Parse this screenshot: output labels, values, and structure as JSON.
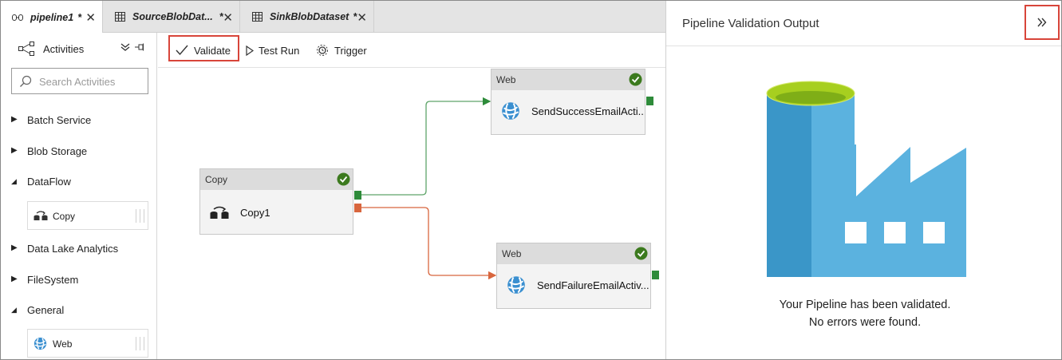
{
  "tabs": [
    {
      "label": "pipeline1",
      "modified": "*",
      "icon": "pipeline-icon"
    },
    {
      "label": "SourceBlobDat...",
      "modified": "*",
      "icon": "table-icon"
    },
    {
      "label": "SinkBlobDataset",
      "modified": "*",
      "icon": "table-icon"
    }
  ],
  "activities": {
    "title": "Activities",
    "search_placeholder": "Search Activities",
    "categories": [
      {
        "label": "Batch Service",
        "expanded": false
      },
      {
        "label": "Blob Storage",
        "expanded": false
      },
      {
        "label": "DataFlow",
        "expanded": true,
        "items": [
          "Copy"
        ]
      },
      {
        "label": "Data Lake Analytics",
        "expanded": false
      },
      {
        "label": "FileSystem",
        "expanded": false
      },
      {
        "label": "General",
        "expanded": true,
        "items": [
          "Web"
        ]
      }
    ]
  },
  "toolbar": {
    "validate_label": "Validate",
    "test_run_label": "Test Run",
    "trigger_label": "Trigger"
  },
  "canvas": {
    "copy_node": {
      "type": "Copy",
      "name": "Copy1"
    },
    "success_node": {
      "type": "Web",
      "name": "SendSuccessEmailActi..."
    },
    "failure_node": {
      "type": "Web",
      "name": "SendFailureEmailActiv..."
    }
  },
  "output": {
    "title": "Pipeline Validation Output",
    "message_line1": "Your Pipeline has been validated.",
    "message_line2": "No errors were found."
  },
  "colors": {
    "highlight": "#d8453a",
    "success": "#2e8b3a",
    "failure": "#d8663e",
    "check": "#3c7a1e",
    "factory_dark": "#3a96c8",
    "factory_light": "#5bb2df",
    "factory_top": "#a7cf1f"
  }
}
